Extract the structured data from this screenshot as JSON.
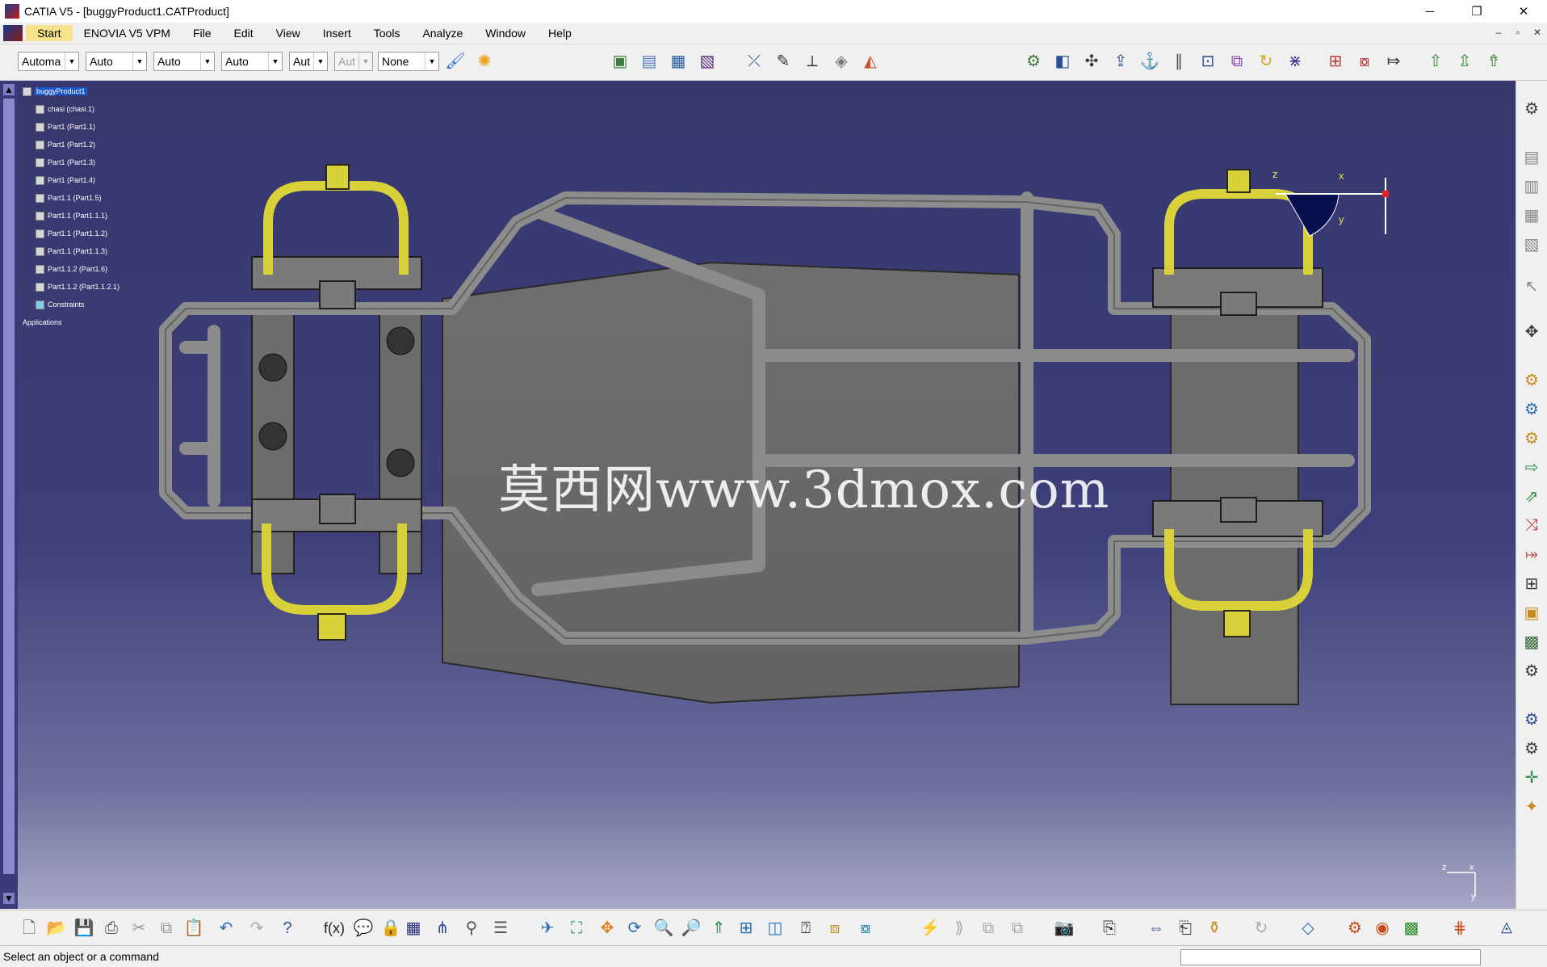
{
  "window": {
    "title": "CATIA V5 - [buggyProduct1.CATProduct]",
    "minimize": "─",
    "restore": "❐",
    "close": "✕"
  },
  "menu": {
    "items": [
      "Start",
      "ENOVIA V5 VPM",
      "File",
      "Edit",
      "View",
      "Insert",
      "Tools",
      "Analyze",
      "Window",
      "Help"
    ],
    "mdi": [
      "–",
      "▫",
      "✕"
    ]
  },
  "toolbar_top": {
    "combos": [
      {
        "value": "Automa",
        "disabled": false
      },
      {
        "value": "Auto",
        "disabled": false
      },
      {
        "value": "Auto",
        "disabled": false
      },
      {
        "value": "Auto",
        "disabled": false
      },
      {
        "value": "Aut",
        "disabled": false
      },
      {
        "value": "Aut",
        "disabled": true
      },
      {
        "value": "None",
        "disabled": false
      }
    ]
  },
  "tree": {
    "root": "buggyProduct1",
    "items": [
      "chasi (chasi.1)",
      "Part1 (Part1.1)",
      "Part1 (Part1.2)",
      "Part1 (Part1.3)",
      "Part1 (Part1.4)",
      "Part1.1 (Part1.5)",
      "Part1.1 (Part1.1.1)",
      "Part1.1 (Part1.1.2)",
      "Part1.1 (Part1.1.3)",
      "Part1.1.2 (Part1.6)",
      "Part1.1.2 (Part1.1.2.1)",
      "Constraints"
    ],
    "applications": "Applications"
  },
  "viewport": {
    "watermark": "莫西网www.3dmox.com",
    "compass": {
      "x": "x",
      "y": "y",
      "z": "z"
    },
    "mini_axis": {
      "x": "x",
      "y": "y",
      "z": "z"
    }
  },
  "icons": {
    "top": [
      "paint-brush-icon",
      "bulb-icon",
      "catalog-icon",
      "product-icon",
      "existing-component-icon",
      "positioned-component-icon",
      "snap-icon",
      "annotation-icon",
      "measure-icon",
      "weld-icon",
      "section-icon",
      "clash-icon",
      "part-icon",
      "assemble-icon",
      "manipulate-icon",
      "explode-icon",
      "constraint-icon",
      "coincidence-icon",
      "contact-icon",
      "offset-icon",
      "angle-icon",
      "fix-icon",
      "update-icon",
      "reuse-icon",
      "scene-icon",
      "publish-icon",
      "exchange-icon"
    ],
    "right": [
      "sketch-icon",
      "component-icon",
      "product-structure-icon",
      "replace-icon",
      "reorder-icon",
      "select-icon",
      "design-mode-icon",
      "bill-of-material-icon",
      "generate-numbering-icon",
      "flexible-icon",
      "pattern-icon",
      "symmetry-icon",
      "split-icon",
      "hole-icon",
      "pocket-icon",
      "snap-right-icon",
      "annotation-right-icon",
      "rotate-icon",
      "translate-icon",
      "axis-icon"
    ],
    "bottom": [
      "new-icon",
      "open-icon",
      "save-icon",
      "print-icon",
      "cut-icon",
      "copy-icon",
      "paste-icon",
      "undo-icon",
      "redo-icon",
      "whats-this-icon",
      "formula-icon",
      "comment-icon",
      "lock-icon",
      "table-icon",
      "tree-icon",
      "magnet-icon",
      "catalog-browser-icon",
      "fly-icon",
      "fit-all-icon",
      "pan-icon",
      "rotate-view-icon",
      "zoom-in-icon",
      "zoom-out-icon",
      "normal-view-icon",
      "multi-view-icon",
      "iso-view-icon",
      "hide-show-icon",
      "swap-icon",
      "render-icon",
      "wireframe-icon",
      "capture-icon",
      "scene-bottom-icon",
      "measure-between-icon",
      "measure-item-icon",
      "inertia-icon",
      "update-bottom-icon",
      "plane-icon",
      "analysis-icon",
      "clash-bottom-icon",
      "stats-icon",
      "grid-icon",
      "catalia-logo-icon"
    ]
  },
  "status": {
    "prompt": "Select an object or a command"
  },
  "colors": {
    "viewport_top": "#37376e",
    "viewport_bottom": "#a7a8c6",
    "tube": "#8b8b8b",
    "plate": "#6a6a6a",
    "yellow_parts": "#d9d13a"
  }
}
